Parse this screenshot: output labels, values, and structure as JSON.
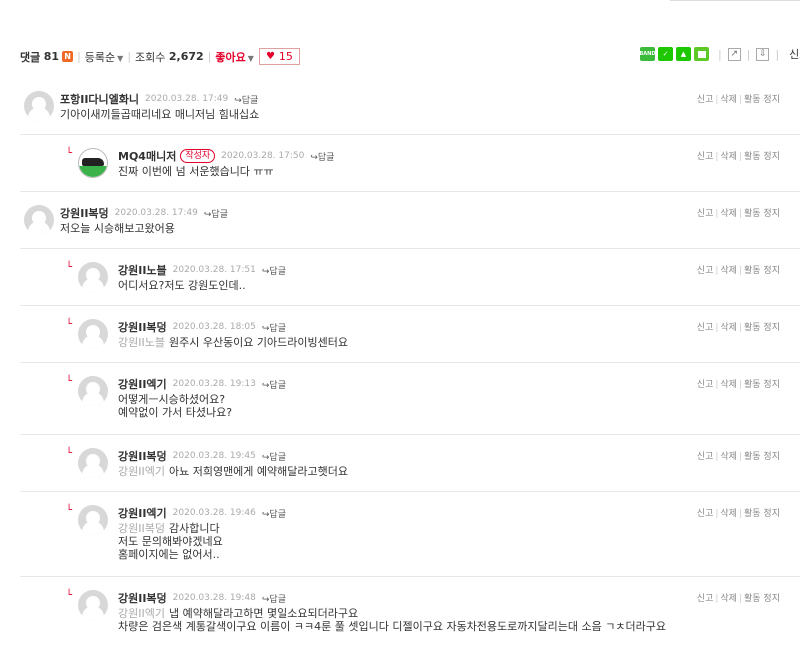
{
  "toolbar": {
    "comments_label": "댓글",
    "comments_count": "81",
    "new_badge": "N",
    "sort_label": "등록순",
    "views_label": "조회수",
    "views_count": "2,672",
    "like_label": "좋아요",
    "like_count": "15",
    "share_icons": [
      "band",
      "blog",
      "cafe",
      "keep"
    ],
    "report_label": "신고"
  },
  "comments": [
    {
      "nick": "포항II다니엘화니",
      "date": "2020.03.28. 17:49",
      "reply": "답글",
      "avatar": "default",
      "indent": false,
      "lines": [
        "기아이새끼들곱때리네요 매니저님 힘내십쇼"
      ]
    },
    {
      "nick": "MQ4매니저",
      "badge": "작성자",
      "date": "2020.03.28. 17:50",
      "reply": "답글",
      "avatar": "mq4",
      "indent": true,
      "lines": [
        "진짜 이번에 넘 서운했습니다 ㅠㅠ"
      ]
    },
    {
      "nick": "강원II복덩",
      "date": "2020.03.28. 17:49",
      "reply": "답글",
      "avatar": "default",
      "indent": false,
      "lines": [
        "저오늘 시승해보고왔어용"
      ]
    },
    {
      "nick": "강원II노블",
      "date": "2020.03.28. 17:51",
      "reply": "답글",
      "avatar": "default",
      "indent": true,
      "lines": [
        "어디서요?저도 강원도인데.."
      ]
    },
    {
      "nick": "강원II복덩",
      "date": "2020.03.28. 18:05",
      "reply": "답글",
      "avatar": "default",
      "indent": true,
      "mention": "강원II노블",
      "lines": [
        "원주시 우산동이요 기아드라이빙센터요"
      ]
    },
    {
      "nick": "강원II엑기",
      "date": "2020.03.28. 19:13",
      "reply": "답글",
      "avatar": "default",
      "indent": true,
      "lines": [
        "어떻게ㅡ시승하셨어요?",
        "예약없이 가서 타셨나요?"
      ]
    },
    {
      "nick": "강원II복덩",
      "date": "2020.03.28. 19:45",
      "reply": "답글",
      "avatar": "default",
      "indent": true,
      "mention": "강원II엑기",
      "lines": [
        "아뇨 저희영맨에게 예약해달라고햇더요"
      ]
    },
    {
      "nick": "강원II엑기",
      "date": "2020.03.28. 19:46",
      "reply": "답글",
      "avatar": "default",
      "indent": true,
      "mention": "강원II복덩",
      "lines": [
        "감사합니다",
        "저도 문의해봐야겠네요",
        "홈페이지에는 없어서.."
      ]
    },
    {
      "nick": "강원II복덩",
      "date": "2020.03.28. 19:48",
      "reply": "답글",
      "avatar": "default",
      "indent": true,
      "mention": "강원II엑기",
      "lines": [
        "냅 예약해달라고하면 몇일소요되더라구요",
        "차량은 검은색 계통갈색이구요 이름이 ㅋㅋ4룬 풀 셋입니다 디젤이구요 자동차전용도로까지달리는대 소음 ㄱㅊ더라구요"
      ]
    }
  ],
  "actions": {
    "report": "신고",
    "delete": "삭제",
    "ban": "활동 정지"
  }
}
